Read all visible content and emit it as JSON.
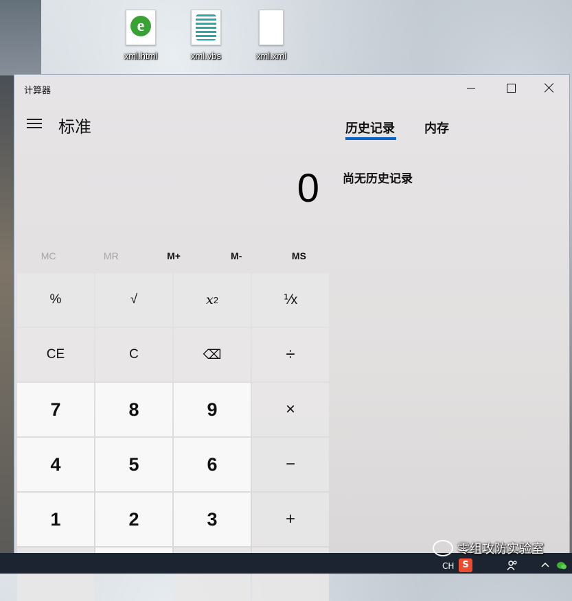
{
  "desktop": {
    "icons": [
      {
        "label": "xml.html",
        "icon": "ie-html-file-icon"
      },
      {
        "label": "xml.vbs",
        "icon": "vbs-script-file-icon"
      },
      {
        "label": "xml.xml",
        "icon": "blank-file-icon"
      }
    ]
  },
  "window": {
    "title": "计算器",
    "controls": {
      "minimize": "minimize-icon",
      "maximize": "maximize-icon",
      "close": "close-icon"
    }
  },
  "calculator": {
    "mode": "标准",
    "display": "0",
    "memory": [
      {
        "label": "MC",
        "enabled": false
      },
      {
        "label": "MR",
        "enabled": false
      },
      {
        "label": "M+",
        "enabled": true
      },
      {
        "label": "M-",
        "enabled": true
      },
      {
        "label": "MS",
        "enabled": true
      }
    ],
    "keys": {
      "percent": "%",
      "sqrt": "√",
      "square_base": "x",
      "square_exp": "2",
      "reciprocal": "⅟x",
      "ce": "CE",
      "c": "C",
      "backspace": "⌫",
      "divide": "÷",
      "seven": "7",
      "eight": "8",
      "nine": "9",
      "multiply": "×",
      "four": "4",
      "five": "5",
      "six": "6",
      "subtract": "−",
      "one": "1",
      "two": "2",
      "three": "3",
      "add": "+"
    }
  },
  "history_pane": {
    "tabs": [
      "历史记录",
      "内存"
    ],
    "active_tab": "历史记录",
    "empty_message": "尚无历史记录"
  },
  "taskbar": {
    "lang": "CH",
    "ime": "S"
  },
  "watermark": "零组攻防实验室",
  "colors": {
    "accent": "#0a64c8",
    "taskbar": "#1b2430"
  }
}
